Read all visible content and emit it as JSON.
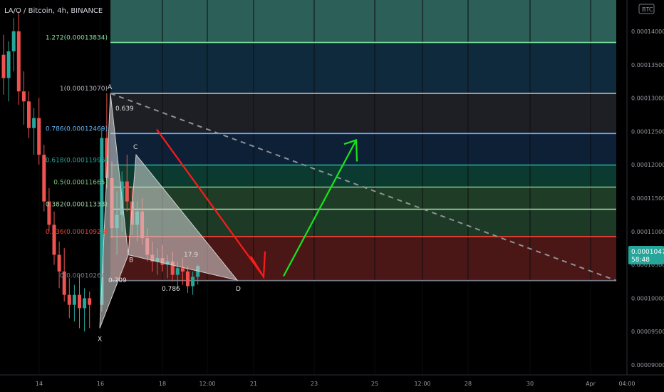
{
  "header": {
    "symbol_label": "LA/O / Bitcoin, 4h, BINANCE",
    "currency_badge": "BTC"
  },
  "price_tag": {
    "price": "0.00010476",
    "countdown": "58:48"
  },
  "colors": {
    "bg": "#000000",
    "up": "#26a69a",
    "down": "#ef5350",
    "axis_text": "#9598a1",
    "trend_down_arrow": "#ff1a1a",
    "trend_up_arrow": "#17e61a",
    "pattern_fill": "#d9d9d9"
  },
  "chart_data": {
    "type": "candlestick",
    "title": "",
    "ylim": [
      8.85e-05,
      0.0001447
    ],
    "y_ticks": [
      "0.00014000",
      "0.00013500",
      "0.00013000",
      "0.00012500",
      "0.00012000",
      "0.00011500",
      "0.00011000",
      "0.00010500",
      "0.00010000",
      "0.00009500",
      "0.00009000"
    ],
    "y_tick_values": [
      0.00014,
      0.000135,
      0.00013,
      0.000125,
      0.00012,
      0.000115,
      0.00011,
      0.000105,
      0.0001,
      9.5e-05,
      9e-05
    ],
    "x_ticks": [
      "14",
      "16",
      "18",
      "12:00",
      "21",
      "23",
      "25",
      "12:00",
      "28",
      "30",
      "Apr",
      "04:00"
    ],
    "fib_levels": [
      {
        "ratio": "1.272",
        "price": "0.00013834",
        "value": 0.00013834,
        "color": "#7ee79f"
      },
      {
        "ratio": "1",
        "price": "0.00013070",
        "value": 0.0001307,
        "color": "#b2b5be"
      },
      {
        "ratio": "0.786",
        "price": "0.00012469",
        "value": 0.00012469,
        "color": "#64b5f6"
      },
      {
        "ratio": "0.618",
        "price": "0.00011996",
        "value": 0.00011996,
        "color": "#26a69a"
      },
      {
        "ratio": "0.5",
        "price": "0.00011665",
        "value": 0.00011665,
        "color": "#7ec17e"
      },
      {
        "ratio": "0.382",
        "price": "0.00011333",
        "value": 0.00011333,
        "color": "#a5d6a7"
      },
      {
        "ratio": "0.236",
        "price": "0.00010923",
        "value": 0.00010923,
        "color": "#f44336"
      },
      {
        "ratio": "0",
        "price": "0.00010264",
        "value": 0.00010264,
        "color": "#787b86"
      }
    ],
    "fib_label_texts": [
      "1.272(0.00013834)",
      "1(0.00013070)",
      "0.786(0.00012469)",
      "0.618(0.00011996)",
      "0.5(0.00011665)",
      "0.382(0.00011333)",
      "0.236(0.00010923)",
      "0(0.00010264)"
    ],
    "pattern_points": [
      {
        "label": "X",
        "value": 9.55e-05
      },
      {
        "label": "A",
        "value": 0.0001307
      },
      {
        "label": "B",
        "value": 0.0001065
      },
      {
        "label": "C",
        "value": 0.0001215
      },
      {
        "label": "D",
        "value": 0.0001027
      }
    ],
    "pattern_ratios": [
      "0.639",
      "0.709",
      "0.786",
      "17.9"
    ],
    "candles": [
      {
        "o": 0.0001365,
        "h": 0.0001395,
        "l": 0.0001305,
        "c": 0.000133
      },
      {
        "o": 0.000133,
        "h": 0.0001385,
        "l": 0.0001295,
        "c": 0.000137
      },
      {
        "o": 0.000137,
        "h": 0.000142,
        "l": 0.000134,
        "c": 0.00014
      },
      {
        "o": 0.00014,
        "h": 0.000143,
        "l": 0.000129,
        "c": 0.000131
      },
      {
        "o": 0.000131,
        "h": 0.000134,
        "l": 0.000126,
        "c": 0.0001295
      },
      {
        "o": 0.0001295,
        "h": 0.000131,
        "l": 0.000124,
        "c": 0.0001255
      },
      {
        "o": 0.0001255,
        "h": 0.0001285,
        "l": 0.0001215,
        "c": 0.000127
      },
      {
        "o": 0.000127,
        "h": 0.00013,
        "l": 0.00012,
        "c": 0.0001215
      },
      {
        "o": 0.0001215,
        "h": 0.000123,
        "l": 0.000113,
        "c": 0.0001145
      },
      {
        "o": 0.0001145,
        "h": 0.0001165,
        "l": 0.00011,
        "c": 0.000111
      },
      {
        "o": 0.000111,
        "h": 0.000113,
        "l": 0.000105,
        "c": 0.0001065
      },
      {
        "o": 0.0001065,
        "h": 0.0001085,
        "l": 0.0001015,
        "c": 0.000104
      },
      {
        "o": 0.000104,
        "h": 0.0001075,
        "l": 9.95e-05,
        "c": 0.0001005
      },
      {
        "o": 0.0001005,
        "h": 0.000103,
        "l": 9.7e-05,
        "c": 9.9e-05
      },
      {
        "o": 9.9e-05,
        "h": 0.000102,
        "l": 9.65e-05,
        "c": 0.0001005
      },
      {
        "o": 0.0001005,
        "h": 0.0001035,
        "l": 9.55e-05,
        "c": 9.85e-05
      },
      {
        "o": 9.85e-05,
        "h": 0.0001015,
        "l": 9.5e-05,
        "c": 0.0001
      },
      {
        "o": 0.0001,
        "h": 0.000101,
        "l": 9.55e-05,
        "c": 9.9e-05
      },
      {
        "o": 9.9e-05,
        "h": 0.0001255,
        "l": 9.8e-05,
        "c": 0.000124
      },
      {
        "o": 0.000124,
        "h": 0.0001307,
        "l": 0.0001165,
        "c": 0.000118
      },
      {
        "o": 0.000118,
        "h": 0.0001205,
        "l": 0.000109,
        "c": 0.0001105
      },
      {
        "o": 0.0001105,
        "h": 0.000116,
        "l": 0.0001065,
        "c": 0.0001125
      },
      {
        "o": 0.0001125,
        "h": 0.000119,
        "l": 0.00011,
        "c": 0.0001175
      },
      {
        "o": 0.0001175,
        "h": 0.0001215,
        "l": 0.000113,
        "c": 0.0001145
      },
      {
        "o": 0.0001145,
        "h": 0.0001165,
        "l": 0.0001095,
        "c": 0.000111
      },
      {
        "o": 0.000111,
        "h": 0.0001145,
        "l": 0.0001085,
        "c": 0.000113
      },
      {
        "o": 0.000113,
        "h": 0.000115,
        "l": 0.000108,
        "c": 0.000109
      },
      {
        "o": 0.000109,
        "h": 0.0001105,
        "l": 0.0001055,
        "c": 0.0001065
      },
      {
        "o": 0.0001065,
        "h": 0.0001085,
        "l": 0.000104,
        "c": 0.0001055
      },
      {
        "o": 0.0001055,
        "h": 0.0001075,
        "l": 0.0001035,
        "c": 0.000106
      },
      {
        "o": 0.000106,
        "h": 0.000108,
        "l": 0.000104,
        "c": 0.000105
      },
      {
        "o": 0.000105,
        "h": 0.0001065,
        "l": 0.000103,
        "c": 0.0001055
      },
      {
        "o": 0.0001055,
        "h": 0.000107,
        "l": 0.0001025,
        "c": 0.0001035
      },
      {
        "o": 0.0001035,
        "h": 0.0001055,
        "l": 0.0001015,
        "c": 0.0001045
      },
      {
        "o": 0.0001045,
        "h": 0.000106,
        "l": 0.000102,
        "c": 0.000104
      },
      {
        "o": 0.000104,
        "h": 0.0001048,
        "l": 0.0001008,
        "c": 0.0001018
      },
      {
        "o": 0.0001018,
        "h": 0.000104,
        "l": 0.0001005,
        "c": 0.0001032
      },
      {
        "o": 0.0001032,
        "h": 0.000105,
        "l": 0.000102,
        "c": 0.0001048
      }
    ]
  }
}
